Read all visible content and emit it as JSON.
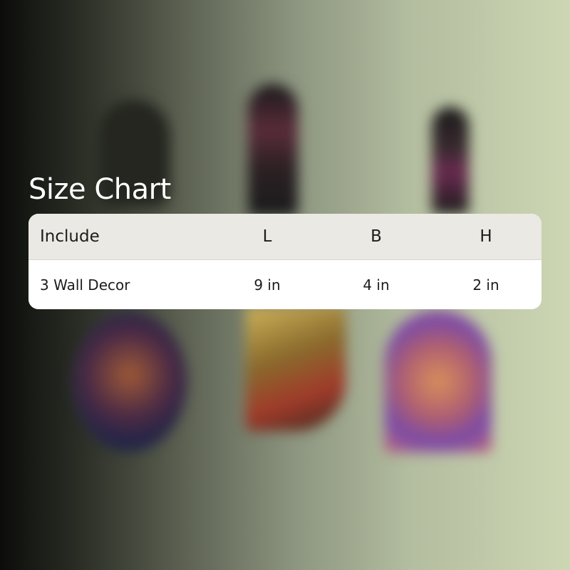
{
  "title": "Size Chart",
  "table": {
    "headers": [
      "Include",
      "L",
      "B",
      "H"
    ],
    "rows": [
      [
        "3 Wall Decor",
        "9 in",
        "4 in",
        "2 in"
      ]
    ]
  },
  "colors": {
    "header_bg": "#ebe9e3",
    "row_bg": "#ffffff",
    "title_text": "#ffffff",
    "cell_text": "#1c1c1c"
  }
}
